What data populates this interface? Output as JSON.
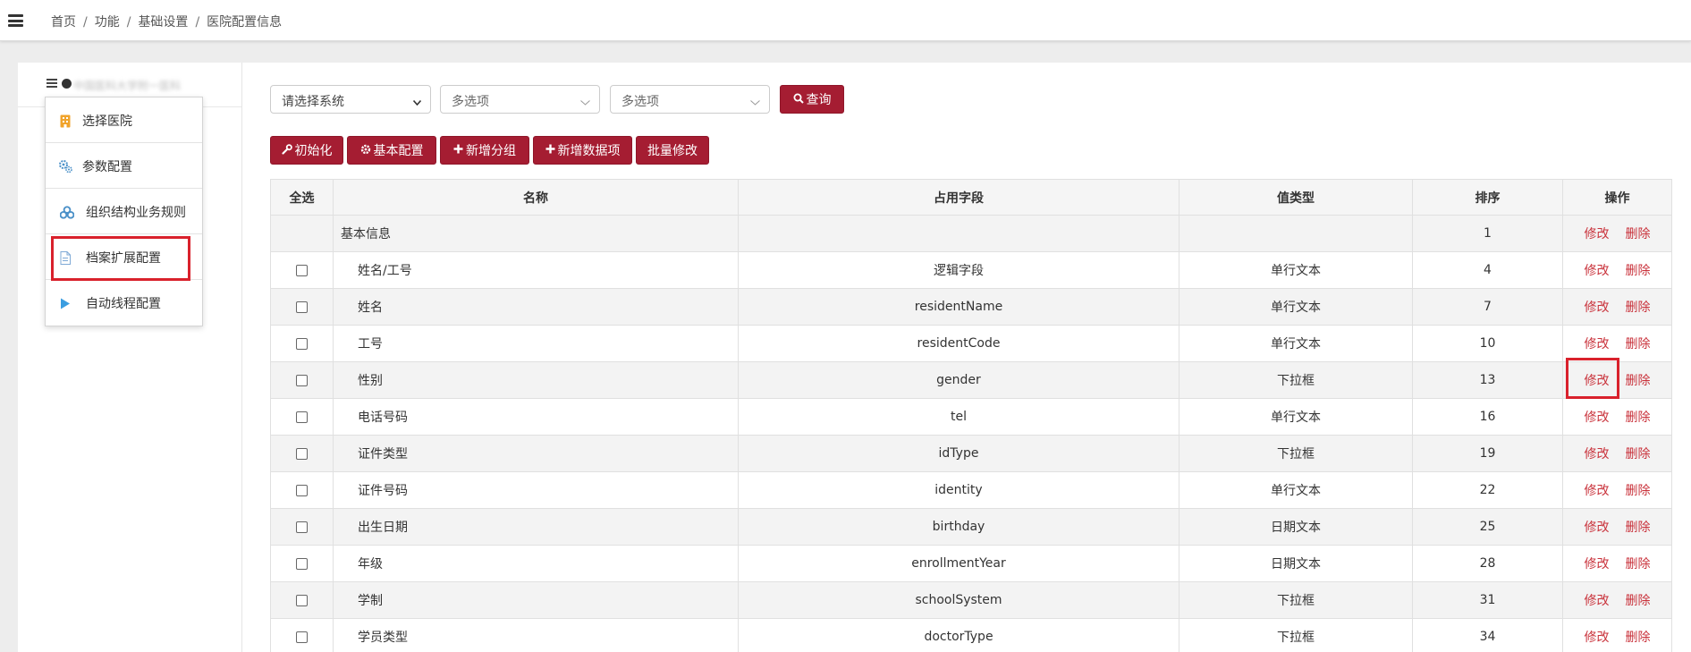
{
  "breadcrumb": {
    "items": [
      "首页",
      "功能",
      "基础设置",
      "医院配置信息"
    ]
  },
  "left_panel": {
    "header_text": "中国医科大学附一医科"
  },
  "dropdown": {
    "items": [
      {
        "label": "选择医院",
        "icon": "hospital-icon"
      },
      {
        "label": "参数配置",
        "icon": "gears-icon"
      },
      {
        "label": "组织结构业务规则",
        "icon": "cubes-icon"
      },
      {
        "label": "档案扩展配置",
        "icon": "document-icon"
      },
      {
        "label": "自动线程配置",
        "icon": "play-icon"
      }
    ]
  },
  "filters": {
    "system_select": "请选择系统",
    "multi1": "多选项",
    "multi2": "多选项",
    "query_label": "查询"
  },
  "toolbar": {
    "init_label": "初始化",
    "basic_config_label": "基本配置",
    "add_group_label": "新增分组",
    "add_item_label": "新增数据项",
    "batch_edit_label": "批量修改"
  },
  "table": {
    "headers": [
      "全选",
      "名称",
      "占用字段",
      "值类型",
      "排序",
      "操作"
    ],
    "edit_label": "修改",
    "delete_label": "删除",
    "rows": [
      {
        "name": "基本信息",
        "field": "",
        "type": "",
        "order": "1",
        "group": true
      },
      {
        "name": "姓名/工号",
        "field": "逻辑字段",
        "type": "单行文本",
        "order": "4"
      },
      {
        "name": "姓名",
        "field": "residentName",
        "type": "单行文本",
        "order": "7"
      },
      {
        "name": "工号",
        "field": "residentCode",
        "type": "单行文本",
        "order": "10"
      },
      {
        "name": "性别",
        "field": "gender",
        "type": "下拉框",
        "order": "13"
      },
      {
        "name": "电话号码",
        "field": "tel",
        "type": "单行文本",
        "order": "16"
      },
      {
        "name": "证件类型",
        "field": "idType",
        "type": "下拉框",
        "order": "19"
      },
      {
        "name": "证件号码",
        "field": "identity",
        "type": "单行文本",
        "order": "22"
      },
      {
        "name": "出生日期",
        "field": "birthday",
        "type": "日期文本",
        "order": "25"
      },
      {
        "name": "年级",
        "field": "enrollmentYear",
        "type": "日期文本",
        "order": "28"
      },
      {
        "name": "学制",
        "field": "schoolSystem",
        "type": "下拉框",
        "order": "31"
      },
      {
        "name": "学员类型",
        "field": "doctorType",
        "type": "下拉框",
        "order": "34"
      }
    ]
  },
  "colors": {
    "accent": "#a51d32",
    "link": "#c9323b",
    "highlight_box": "#d9212c"
  }
}
